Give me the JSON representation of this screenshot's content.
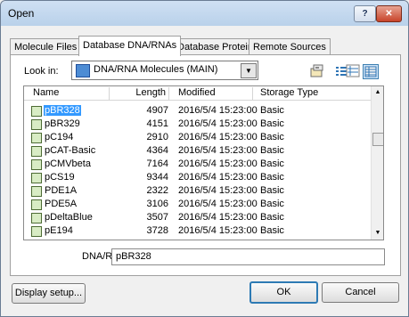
{
  "window": {
    "title": "Open",
    "help_label": "?",
    "close_label": "✕"
  },
  "tabs": [
    {
      "label": "Molecule Files"
    },
    {
      "label": "Database DNA/RNAs"
    },
    {
      "label": "Database Proteins"
    },
    {
      "label": "Remote Sources"
    }
  ],
  "lookin": {
    "label": "Look in:",
    "value": "DNA/RNA Molecules (MAIN)",
    "icon": "database-icon"
  },
  "toolbar": {
    "folder_icon": "database-folder-icon",
    "list_icon": "list-view-icon",
    "details_icon": "details-view-icon",
    "grid_icon": "grid-view-icon"
  },
  "list": {
    "columns": [
      "Name",
      "Length",
      "Modified",
      "Storage Type"
    ],
    "rows": [
      {
        "name": "pBR328",
        "length": "4907",
        "modified": "2016/5/4 15:23:00",
        "storage": "Basic"
      },
      {
        "name": "pBR329",
        "length": "4151",
        "modified": "2016/5/4 15:23:00",
        "storage": "Basic"
      },
      {
        "name": "pC194",
        "length": "2910",
        "modified": "2016/5/4 15:23:00",
        "storage": "Basic"
      },
      {
        "name": "pCAT-Basic",
        "length": "4364",
        "modified": "2016/5/4 15:23:00",
        "storage": "Basic"
      },
      {
        "name": "pCMVbeta",
        "length": "7164",
        "modified": "2016/5/4 15:23:00",
        "storage": "Basic"
      },
      {
        "name": "pCS19",
        "length": "9344",
        "modified": "2016/5/4 15:23:00",
        "storage": "Basic"
      },
      {
        "name": "PDE1A",
        "length": "2322",
        "modified": "2016/5/4 15:23:00",
        "storage": "Basic"
      },
      {
        "name": "PDE5A",
        "length": "3106",
        "modified": "2016/5/4 15:23:00",
        "storage": "Basic"
      },
      {
        "name": "pDeltaBlue",
        "length": "3507",
        "modified": "2016/5/4 15:23:00",
        "storage": "Basic"
      },
      {
        "name": "pE194",
        "length": "3728",
        "modified": "2016/5/4 15:23:00",
        "storage": "Basic"
      }
    ]
  },
  "dna": {
    "label": "DNA/RNA",
    "value": "pBR328"
  },
  "buttons": {
    "display_setup": "Display setup...",
    "ok": "OK",
    "cancel": "Cancel"
  }
}
